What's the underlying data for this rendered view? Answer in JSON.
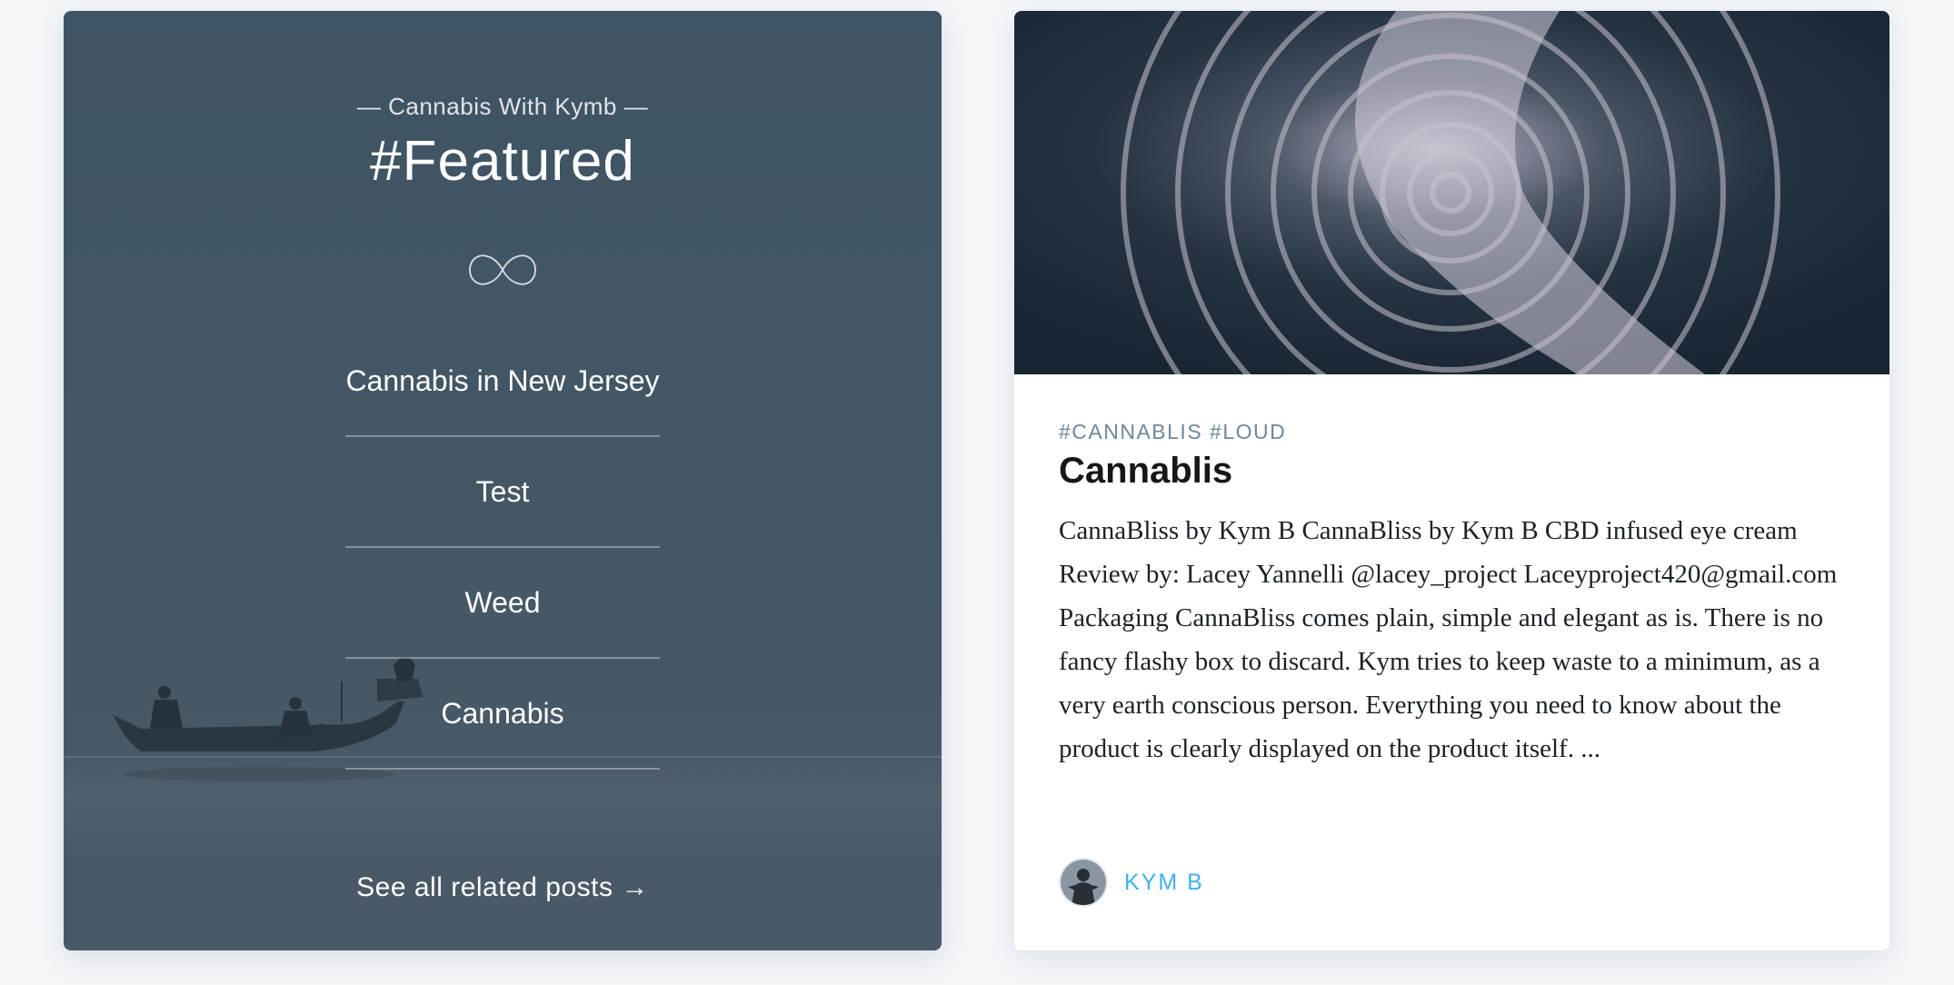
{
  "featured": {
    "kicker": "— Cannabis With Kymb —",
    "title": "#Featured",
    "icon": "infinity-icon",
    "posts": [
      {
        "label": "Cannabis in New Jersey"
      },
      {
        "label": "Test"
      },
      {
        "label": "Weed"
      },
      {
        "label": "Cannabis"
      }
    ],
    "see_all": "See all related posts →"
  },
  "post": {
    "image": "water-ripple-image",
    "tags": "#CANNABLIS #LOUD",
    "title": "Cannablis",
    "excerpt": "CannaBliss by Kym B CannaBliss by Kym B CBD infused eye cream Review by: Lacey Yannelli @lacey_project Laceyproject420@gmail.com Packaging CannaBliss comes plain, simple and elegant as is. There is no fancy flashy box to discard. Kym tries to keep waste to a minimum, as a very earth conscious person. Everything you need to know about the product is clearly displayed on the product itself. ...",
    "author": "KYM B"
  },
  "colors": {
    "accent": "#3eb0ef",
    "featured_bg": "#435765",
    "tag": "#6f8796"
  }
}
